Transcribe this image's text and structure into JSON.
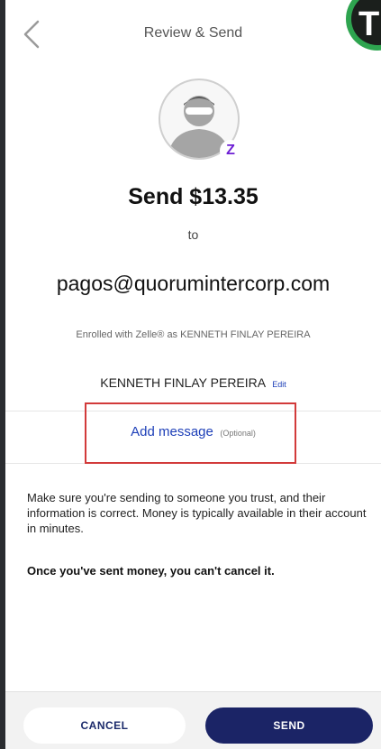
{
  "header": {
    "title": "Review & Send",
    "back_icon": "chevron-left-icon",
    "corner_badge_text": "T"
  },
  "avatar": {
    "icon": "user-silhouette-icon",
    "badge_text": "Z",
    "badge_color": "#6d1ed4"
  },
  "payment": {
    "amount_text": "Send $13.35",
    "to_label": "to",
    "recipient_email": "pagos@quorumintercorp.com",
    "enrolled_text": "Enrolled with Zelle® as KENNETH FINLAY PEREIRA",
    "recipient_name": "KENNETH FINLAY PEREIRA",
    "edit_label": "Edit"
  },
  "message": {
    "add_label": "Add message",
    "optional_label": "(Optional)"
  },
  "notice": {
    "disclaimer": "Make sure you're sending to someone you trust, and their information is correct. Money is typically available in their account in minutes.",
    "warning": "Once you've sent money, you can't cancel it."
  },
  "footer": {
    "cancel_label": "CANCEL",
    "send_label": "SEND"
  },
  "colors": {
    "link": "#1d3fb8",
    "send_button": "#1b2466",
    "highlight_box": "#d23a3a",
    "zelle_purple": "#6d1ed4"
  }
}
